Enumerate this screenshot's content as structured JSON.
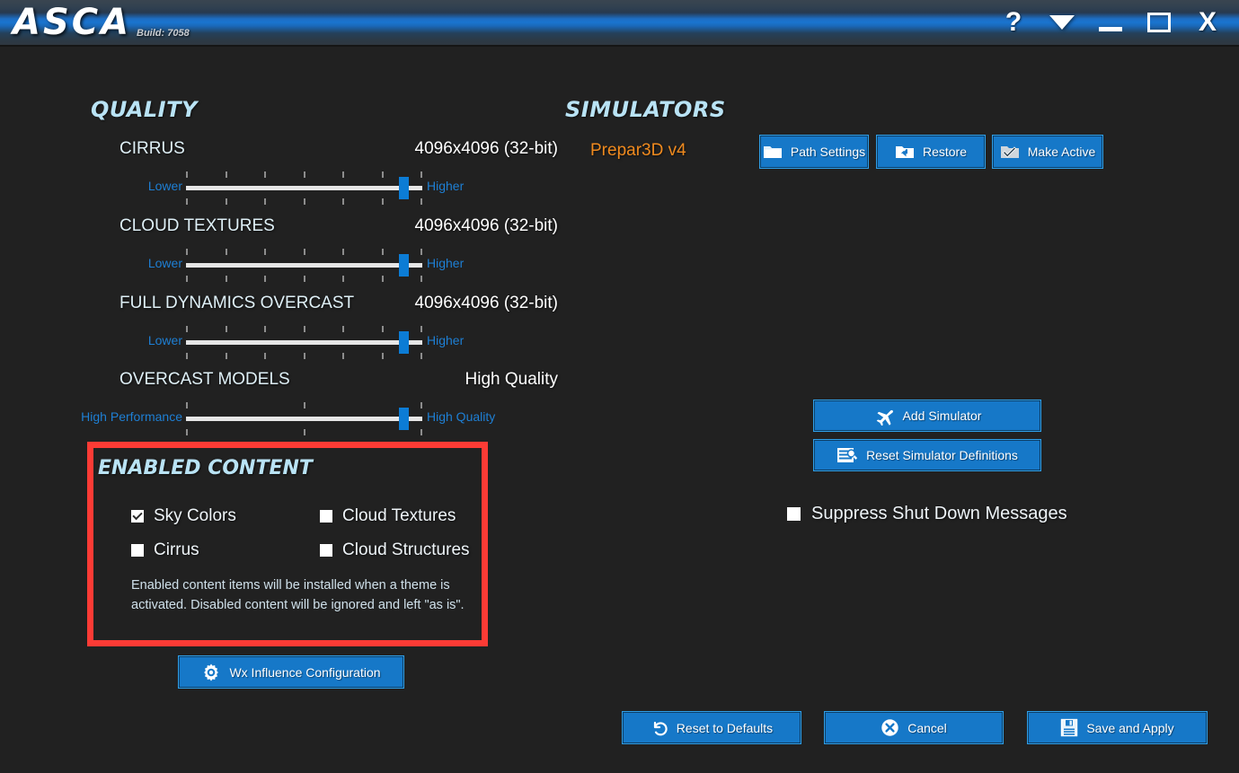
{
  "window": {
    "logo": "ASCA",
    "build": "Build: 7058",
    "controls": {
      "help": "?",
      "menu": "menu-chevron",
      "minimize": "minimize",
      "maximize": "maximize",
      "close": "X"
    }
  },
  "quality": {
    "heading": "QUALITY",
    "sliders": [
      {
        "name": "CIRRUS",
        "value": "4096x4096 (32-bit)",
        "left_label": "Lower",
        "right_label": "Higher",
        "ticks": 7,
        "position_pct": 94
      },
      {
        "name": "CLOUD TEXTURES",
        "value": "4096x4096 (32-bit)",
        "left_label": "Lower",
        "right_label": "Higher",
        "ticks": 7,
        "position_pct": 94
      },
      {
        "name": "FULL DYNAMICS OVERCAST",
        "value": "4096x4096 (32-bit)",
        "left_label": "Lower",
        "right_label": "Higher",
        "ticks": 7,
        "position_pct": 94
      },
      {
        "name": "OVERCAST MODELS",
        "value": "High Quality",
        "left_label": "High Performance",
        "right_label": "High Quality",
        "ticks": 3,
        "position_pct": 94
      }
    ]
  },
  "enabled_content": {
    "heading": "ENABLED CONTENT",
    "items": [
      {
        "label": "Sky Colors",
        "checked": true
      },
      {
        "label": "Cloud Textures",
        "checked": false
      },
      {
        "label": "Cirrus",
        "checked": false
      },
      {
        "label": "Cloud Structures",
        "checked": false
      }
    ],
    "note": "Enabled content items will be installed when a theme is activated.  Disabled content will be ignored and left \"as is\".",
    "highlight_color": "#fc3b35"
  },
  "simulators": {
    "heading": "SIMULATORS",
    "active_simulator": "Prepar3D v4",
    "buttons": {
      "path_settings": "Path Settings",
      "restore": "Restore",
      "make_active": "Make Active",
      "add_simulator": "Add Simulator",
      "reset_definitions": "Reset Simulator Definitions"
    },
    "suppress_shutdown": {
      "label": "Suppress Shut Down Messages",
      "checked": false
    }
  },
  "actions": {
    "wx_influence": "Wx Influence Configuration",
    "reset_to_defaults": "Reset to Defaults",
    "cancel": "Cancel",
    "save_and_apply": "Save and Apply"
  },
  "colors": {
    "background": "#212121",
    "accent_blue": "#1678c8",
    "heading_cyan": "#b9e3f5",
    "sim_orange": "#f08a1e",
    "slider_blue": "#0c7cd5",
    "highlight_red": "#fc3b35"
  }
}
